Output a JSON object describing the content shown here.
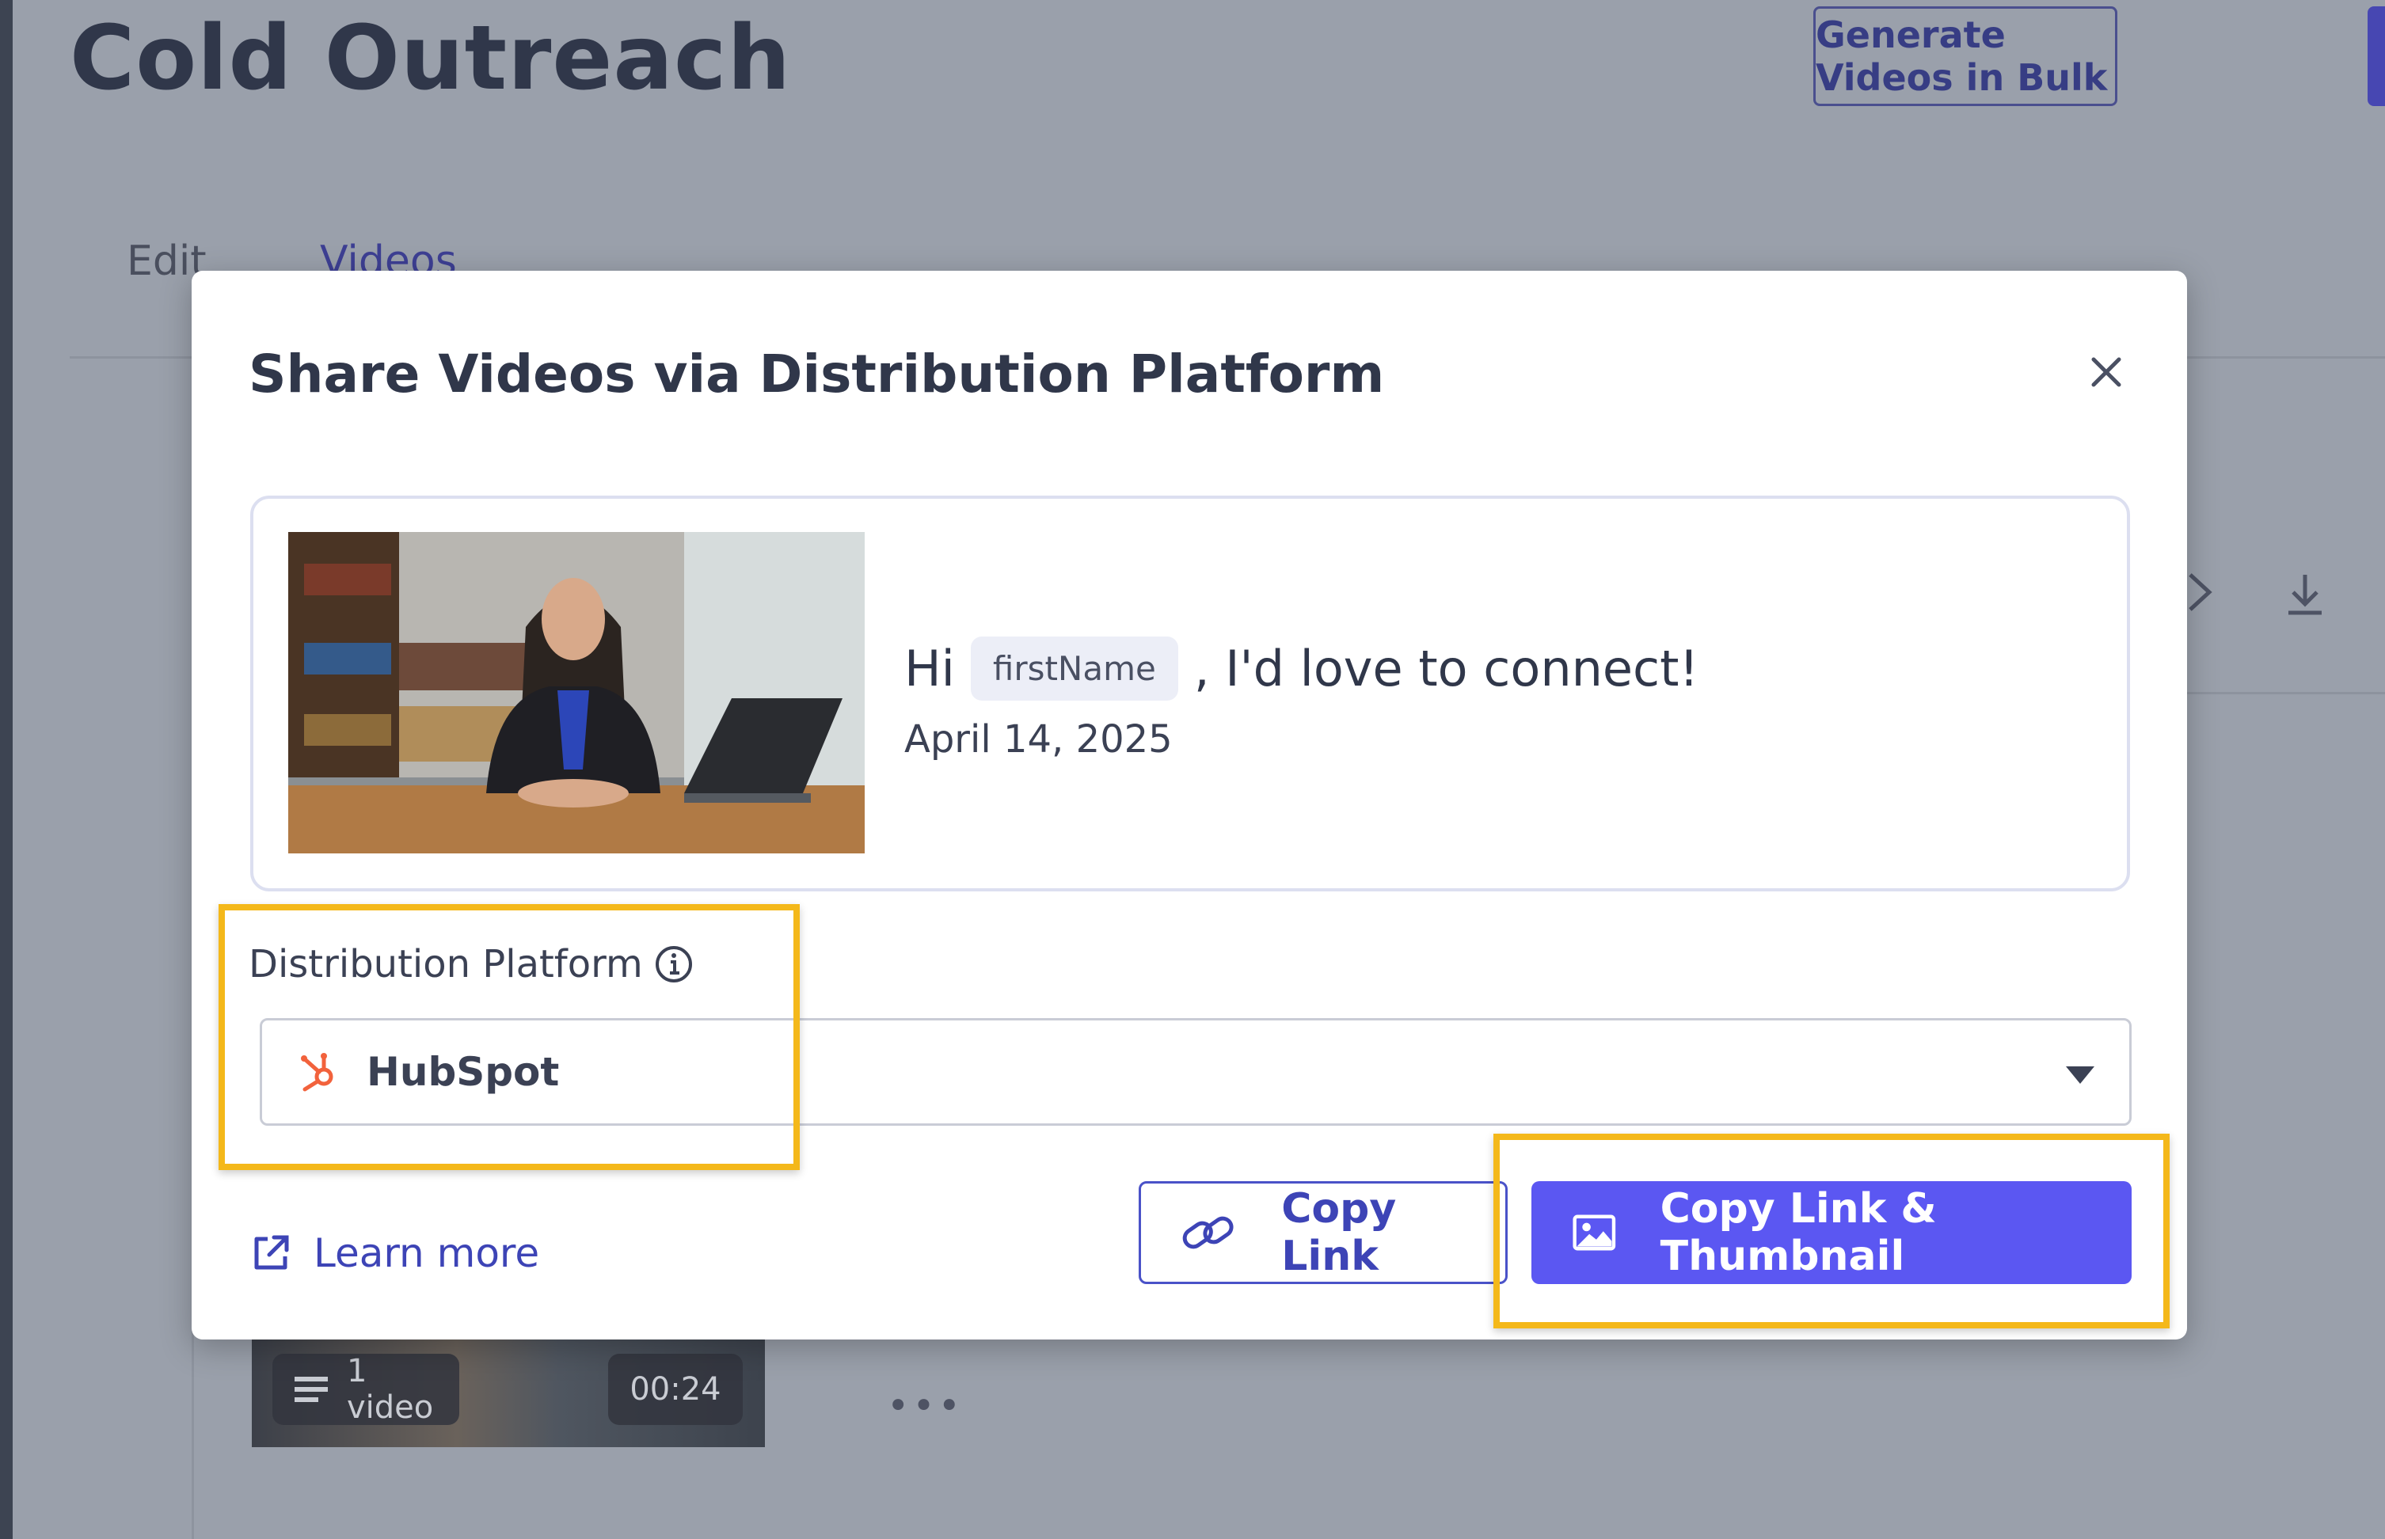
{
  "page": {
    "title": "Cold Outreach",
    "generate_bulk_label": "Generate Videos in Bulk",
    "tabs": [
      {
        "label": "Edit"
      },
      {
        "label": "Videos"
      }
    ],
    "video_item": {
      "count_label": "1 video",
      "duration": "00:24"
    }
  },
  "modal": {
    "title": "Share Videos via Distribution Platform",
    "preview": {
      "greeting_prefix": "Hi",
      "variable_chip": "firstName",
      "greeting_suffix": ", I'd love to connect!",
      "date": "April 14, 2025"
    },
    "platform_label": "Distribution Platform",
    "platform_selected": "HubSpot",
    "learn_more_label": "Learn more",
    "copy_link_label": "Copy Link",
    "copy_link_thumbnail_label": "Copy Link & Thumbnail"
  },
  "colors": {
    "accent": "#5b57f2",
    "link": "#3d44b6",
    "highlight": "#f4b81a",
    "hubspot": "#f2623c"
  },
  "icons": [
    "close-icon",
    "info-icon",
    "hubspot-icon",
    "chevron-down-icon",
    "external-link-icon",
    "link-icon",
    "image-icon",
    "download-icon",
    "menu-lines-icon",
    "more-icon"
  ]
}
